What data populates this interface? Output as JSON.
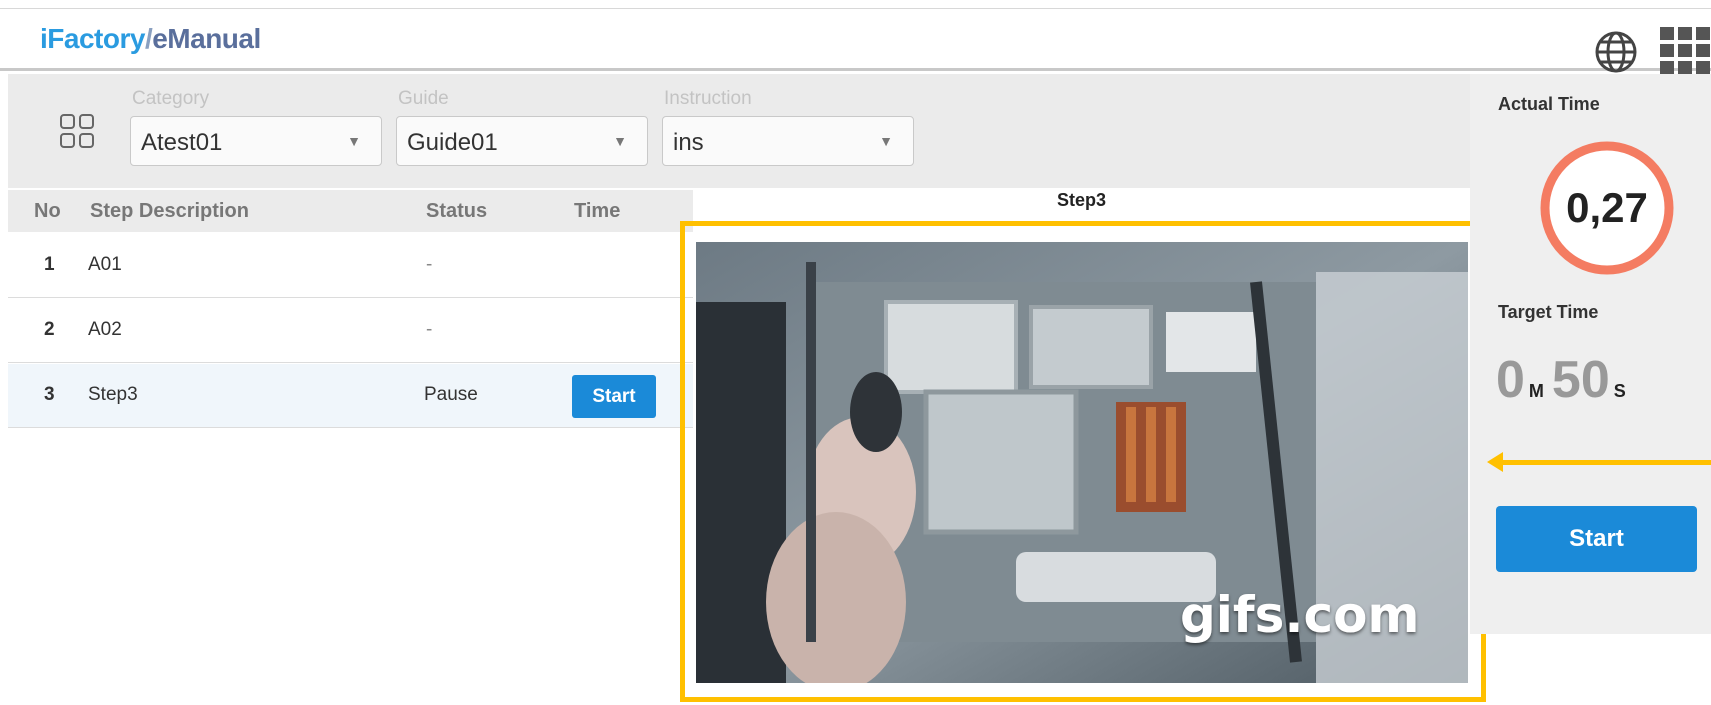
{
  "app": {
    "brand_part1": "iFactory",
    "brand_sep": "/",
    "brand_part2": "eManual"
  },
  "header": {
    "globe_icon": "globe-icon",
    "apps_icon": "apps-grid-icon"
  },
  "filters": {
    "category": {
      "label": "Category",
      "value": "Atest01"
    },
    "guide": {
      "label": "Guide",
      "value": "Guide01"
    },
    "instruction": {
      "label": "Instruction",
      "value": "ins"
    },
    "arrow": "▼"
  },
  "table": {
    "headers": {
      "no": "No",
      "desc": "Step Description",
      "status": "Status",
      "time": "Time"
    },
    "rows": [
      {
        "no": "1",
        "desc": "A01",
        "status": "-"
      },
      {
        "no": "2",
        "desc": "A02",
        "status": "-"
      },
      {
        "no": "3",
        "desc": "Step3",
        "status": "Pause",
        "button": "Start"
      }
    ]
  },
  "step": {
    "title": "Step3",
    "media_watermark": "gifs.com"
  },
  "side": {
    "actual_label": "Actual Time",
    "actual_value": "0,27",
    "target_label": "Target Time",
    "target_minutes": "0",
    "minutes_unit": "M",
    "target_seconds": "50",
    "seconds_unit": "S",
    "start_label": "Start"
  },
  "colors": {
    "accent": "#1b8ad8",
    "highlight": "#ffc000",
    "gauge_ring": "#f47c62"
  }
}
